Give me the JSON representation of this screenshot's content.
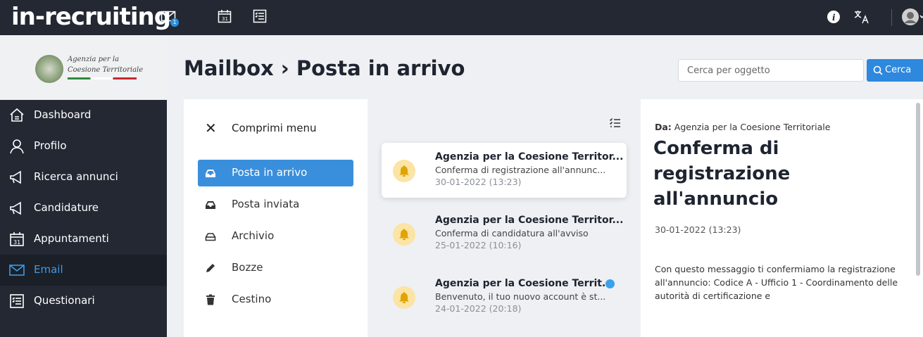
{
  "app": {
    "logo": "in-recruiting"
  },
  "topbar": {
    "mail_badge": "1",
    "icons": [
      "mail-icon",
      "calendar-icon",
      "checklist-icon",
      "info-icon",
      "translate-icon",
      "avatar"
    ]
  },
  "brand": {
    "line1": "Agenzia per la",
    "line2": "Coesione Territoriale"
  },
  "sidebar": {
    "items": [
      {
        "label": "Dashboard",
        "icon": "home-icon"
      },
      {
        "label": "Profilo",
        "icon": "user-icon"
      },
      {
        "label": "Ricerca annunci",
        "icon": "megaphone-icon"
      },
      {
        "label": "Candidature",
        "icon": "megaphone-icon"
      },
      {
        "label": "Appuntamenti",
        "icon": "calendar-icon"
      },
      {
        "label": "Email",
        "icon": "mail-icon",
        "active": true
      },
      {
        "label": "Questionari",
        "icon": "checklist-icon"
      }
    ]
  },
  "header": {
    "title": "Mailbox › Posta in arrivo",
    "search_placeholder": "Cerca per oggetto",
    "search_button": "Cerca"
  },
  "folders": {
    "collapse_label": "Comprimi menu",
    "items": [
      {
        "label": "Posta in arrivo",
        "icon": "inbox-icon",
        "active": true
      },
      {
        "label": "Posta inviata",
        "icon": "outbox-icon"
      },
      {
        "label": "Archivio",
        "icon": "archive-icon"
      },
      {
        "label": "Bozze",
        "icon": "pencil-icon"
      },
      {
        "label": "Cestino",
        "icon": "trash-icon"
      }
    ]
  },
  "messages": [
    {
      "from": "Agenzia per la Coesione Territor...",
      "subject": "Conferma di registrazione all'annunc...",
      "date": "30-01-2022 (13:23)",
      "selected": true,
      "unread": false
    },
    {
      "from": "Agenzia per la Coesione Territor...",
      "subject": "Conferma di candidatura all'avviso",
      "date": "25-01-2022 (10:16)",
      "selected": false,
      "unread": false
    },
    {
      "from": "Agenzia per la Coesione Territ...",
      "subject": "Benvenuto, il tuo nuovo account è st...",
      "date": "24-01-2022 (20:18)",
      "selected": false,
      "unread": true
    }
  ],
  "detail": {
    "from_label": "Da:",
    "from": "Agenzia per la Coesione Territoriale",
    "title": "Conferma di registrazione all'annuncio",
    "date": "30-01-2022 (13:23)",
    "body": "Con questo messaggio ti confermiamo la registrazione all'annuncio: Codice A - Ufficio 1 - Coordinamento delle autorità di certificazione e"
  },
  "colors": {
    "topbar": "#232833",
    "accent": "#2e88de",
    "active_folder": "#3a8fdc",
    "bell_bg": "#fbe4a4",
    "unread_dot": "#3aa2ea"
  }
}
